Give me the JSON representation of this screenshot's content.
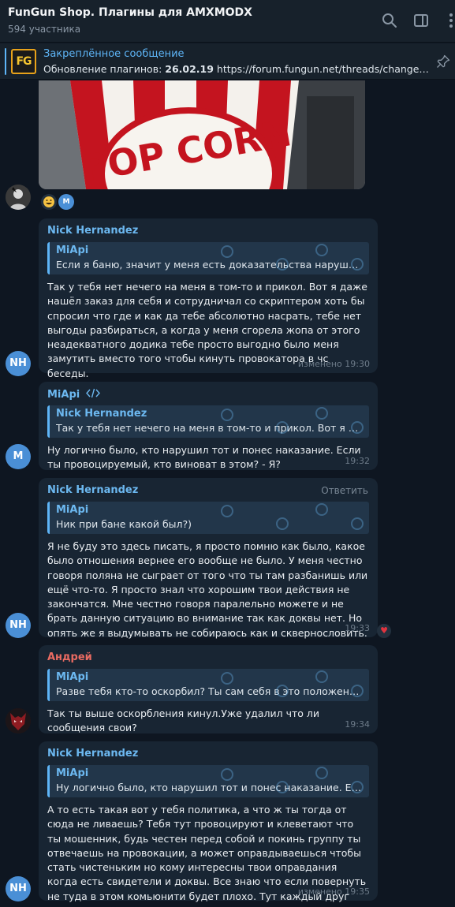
{
  "header": {
    "title": "FunGun Shop. Плагины для AMXMODX",
    "subtitle": "594 участника",
    "icons": [
      "search-icon",
      "sidebar-toggle-icon",
      "more-vertical-icon"
    ]
  },
  "pinned": {
    "label": "Закреплённое сообщение",
    "logo_text": "FG",
    "text_prefix": "Обновление плагинов: ",
    "text_date": "26.02.19",
    "text_url": " https://forum.fungun.net/threads/changelo..."
  },
  "media": {
    "label": "POP CORN"
  },
  "reactions": [
    "grinning-emoji",
    "M"
  ],
  "messages": [
    {
      "avatar": "NH",
      "avatar_color": "#4a8fd6",
      "author": "Nick Hernandez",
      "reply_action": "",
      "quote_author": "MiApi",
      "quote_text": "Если я баню, значит у меня есть доказательства нарушение г...",
      "text": "Так у тебя нет нечего на меня в том-то и прикол. Вот я даже нашёл заказ для себя и сотрудничал со скриптером хоть бы спросил что где и как да тебе абсолютно насрать, тебе нет выгоды разбираться, а когда у меня сгорела жопа от этого неадекватного додика тебе просто выгодно было меня замутить вместо того чтобы кинуть провокатора в чс беседы.",
      "time": "изменено 19:30"
    },
    {
      "avatar": "M",
      "avatar_color": "#4a8fd6",
      "author": "MiApi",
      "reply_action": "",
      "quote_author": "Nick Hernandez",
      "quote_text": "Так у тебя нет нечего на меня в том-то и прикол. Вот я даже ...",
      "text": "Ну логично было, кто нарушил тот и понес наказание. Если ты провоцируемый, кто виноват в этом? - Я?",
      "time": "19:32"
    },
    {
      "avatar": "NH",
      "avatar_color": "#4a8fd6",
      "author": "Nick Hernandez",
      "reply_action": "Ответить",
      "quote_author": "MiApi",
      "quote_text": "Ник при бане какой был?)",
      "text": "Я не буду это здесь писать, я просто помню как было, какое было отношения вернее его вообще не было. У меня честно говоря поляна не сыграет от того что ты там разбанишь или ещё что-то. Я просто знал что хорошим твои действия не закончатся. Мне честно говоря паралельно можете и не брать данную ситуацию во внимание так как доквы нет. Но опять же я выдумывать не собираюсь как и сквернословить.",
      "time": "19:33",
      "reaction": "♥"
    },
    {
      "avatar": "",
      "avatar_color": "#2a1a1e",
      "author": "Андрей",
      "reply_action": "",
      "quote_author": "MiApi",
      "quote_text": "Разве тебя кто-то оскорбил? Ты сам себя в это положения по...",
      "text": "Так ты выше оскорбления кинул.Уже удалил что ли сообщения свои?",
      "time": "19:34"
    },
    {
      "avatar": "NH",
      "avatar_color": "#4a8fd6",
      "author": "Nick Hernandez",
      "reply_action": "",
      "quote_author": "MiApi",
      "quote_text": "Ну логично было, кто нарушил тот и понес наказание. Если т...",
      "text": "А то есть такая вот у тебя политика, а что ж ты тогда от сюда не ливаешь? Тебя тут провоцируют и клеветают что ты мошенник, будь честен перед собой и покинь группу ты отвечаешь на провокации, а может оправдываешься чтобы стать чистеньким но кому интересны твои оправдания когда есть свидетели и доквы. Все знаю что если повернуть не туда в этом комьюнити будет плохо. Тут каждый друг друга знает.",
      "time": "изменено 19:35"
    }
  ]
}
